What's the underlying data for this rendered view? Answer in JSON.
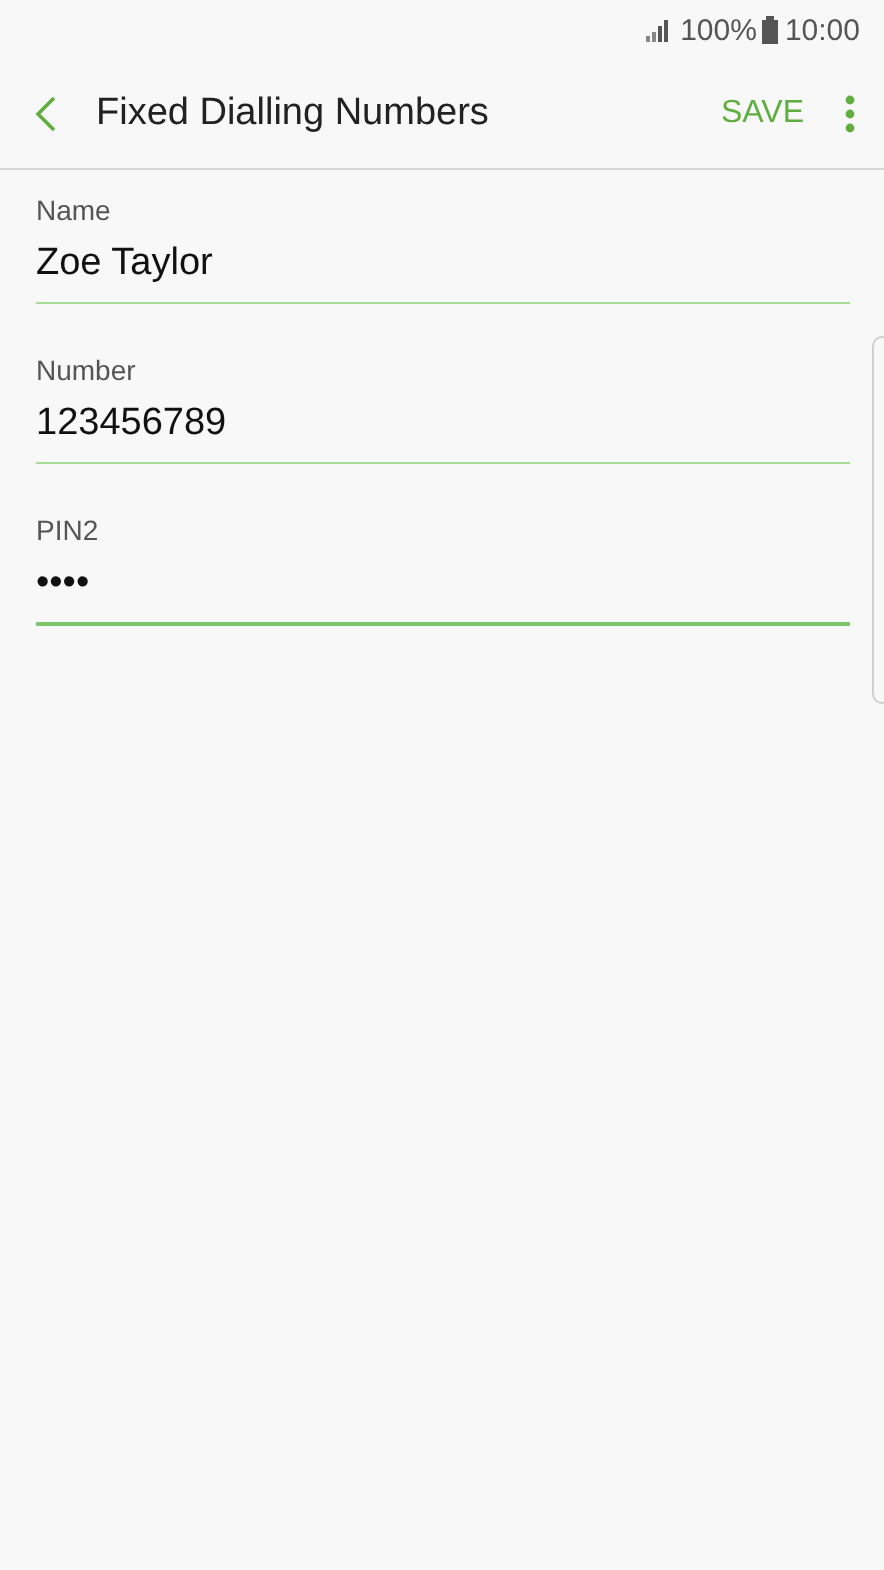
{
  "status_bar": {
    "battery": "100%",
    "time": "10:00"
  },
  "toolbar": {
    "title": "Fixed Dialling Numbers",
    "action": "SAVE"
  },
  "fields": [
    {
      "label": "Name",
      "value": "Zoe Taylor",
      "focused": false
    },
    {
      "label": "Number",
      "value": "123456789",
      "focused": false
    },
    {
      "label": "PIN2",
      "value": "••••",
      "focused": true
    }
  ]
}
